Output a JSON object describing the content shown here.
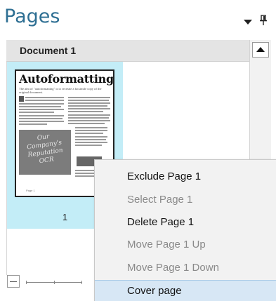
{
  "pane": {
    "title": "Pages"
  },
  "document": {
    "label": "Document 1"
  },
  "pages": [
    {
      "number": "1",
      "thumbnail": {
        "title": "Autoformatting",
        "subtitle": "The aim of \"autoformatting\" is to recreate a facsimile copy of the original document.",
        "image_text": "Our Company's Reputation OCR",
        "footer": "Page 1"
      }
    }
  ],
  "context_menu": {
    "items": [
      {
        "label": "Exclude Page 1",
        "enabled": true
      },
      {
        "label": "Select Page 1",
        "enabled": false
      },
      {
        "label": "Delete Page 1",
        "enabled": true
      },
      {
        "label": "Move Page 1 Up",
        "enabled": false
      },
      {
        "label": "Move Page 1 Down",
        "enabled": false
      },
      {
        "label": "Cover page",
        "enabled": true
      }
    ]
  },
  "icons": {
    "dropdown": "triangle-down-icon",
    "pin": "pin-icon",
    "scroll_up": "arrow-up-icon",
    "zoom_out": "minus-icon"
  },
  "colors": {
    "title": "#2e6f93",
    "selected_page": "#c3edf7",
    "menu_hover": "#d7e7f5"
  }
}
